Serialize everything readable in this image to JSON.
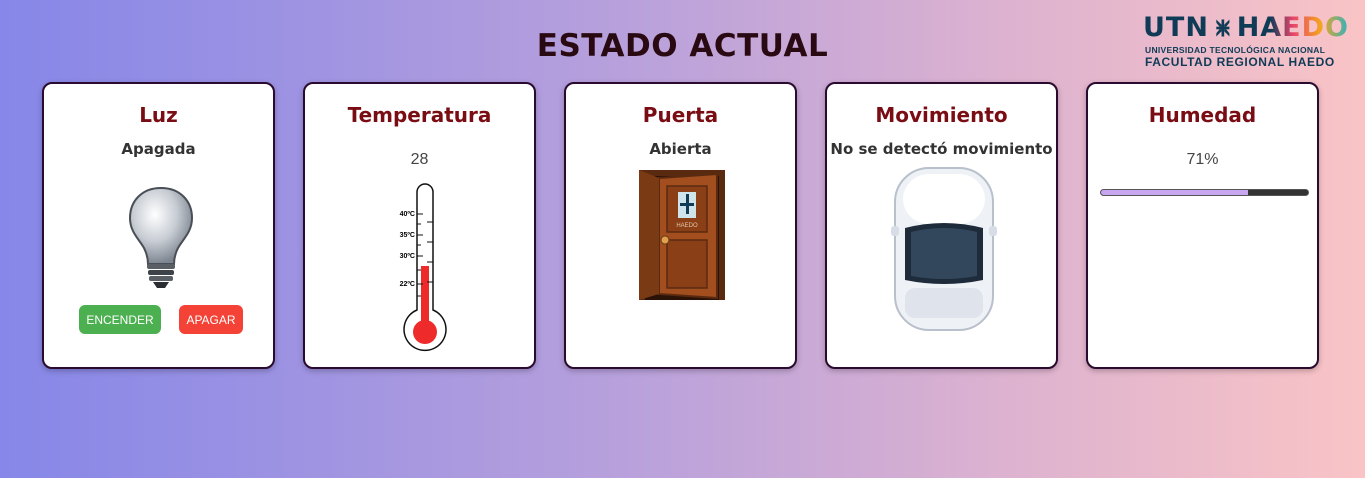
{
  "header": {
    "title": "ESTADO ACTUAL"
  },
  "logo": {
    "utn": "UTN",
    "haedo": "HAEDO",
    "line1": "UNIVERSIDAD TECNOLÓGICA NACIONAL",
    "line2": "FACULTAD REGIONAL HAEDO"
  },
  "cards": {
    "luz": {
      "title": "Luz",
      "state": "Apagada",
      "on_label": "ENCENDER",
      "off_label": "APAGAR"
    },
    "temperatura": {
      "title": "Temperatura",
      "value": "28",
      "scale": [
        "40ºC",
        "35ºC",
        "30ºC",
        "22ºC"
      ]
    },
    "puerta": {
      "title": "Puerta",
      "state": "Abierta",
      "door_logo": "HAEDO"
    },
    "movimiento": {
      "title": "Movimiento",
      "state": "No se detectó movimiento"
    },
    "humedad": {
      "title": "Humedad",
      "value": "71%",
      "level": 0.71
    }
  },
  "colors": {
    "title": "#7a0d14",
    "button_on": "#4caf50",
    "button_off": "#f44336",
    "progress": "#c9a6f2"
  }
}
